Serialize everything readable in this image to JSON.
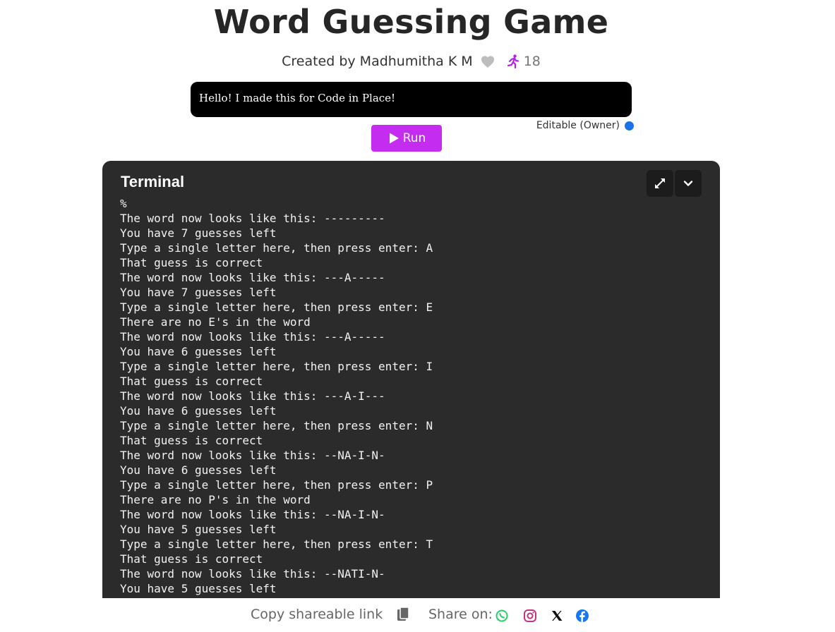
{
  "header": {
    "title": "Word Guessing Game",
    "created_by": "Created by Madhumitha K M",
    "run_count": "18"
  },
  "message": {
    "text": "Hello! I made this for Code in Place!",
    "editable_label": "Editable (Owner)"
  },
  "run_button": {
    "label": "Run",
    "color": "#c42cf0"
  },
  "terminal": {
    "title": "Terminal",
    "lines": [
      "%",
      "The word now looks like this: ---------",
      "You have 7 guesses left",
      "Type a single letter here, then press enter: A",
      "That guess is correct",
      "The word now looks like this: ---A-----",
      "You have 7 guesses left",
      "Type a single letter here, then press enter: E",
      "There are no E's in the word",
      "The word now looks like this: ---A-----",
      "You have 6 guesses left",
      "Type a single letter here, then press enter: I",
      "That guess is correct",
      "The word now looks like this: ---A-I---",
      "You have 6 guesses left",
      "Type a single letter here, then press enter: N",
      "That guess is correct",
      "The word now looks like this: --NA-I-N-",
      "You have 6 guesses left",
      "Type a single letter here, then press enter: P",
      "There are no P's in the word",
      "The word now looks like this: --NA-I-N-",
      "You have 5 guesses left",
      "Type a single letter here, then press enter: T",
      "That guess is correct",
      "The word now looks like this: --NATI-N-",
      "You have 5 guesses left"
    ]
  },
  "footer": {
    "copy_link_label": "Copy shareable link",
    "share_label": "Share on:"
  },
  "icons": {
    "heart": "heart-icon",
    "runner": "runner-icon",
    "play": "play-icon",
    "expand": "expand-icon",
    "collapse": "chevron-down-icon",
    "clipboard": "clipboard-icon",
    "whatsapp": "whatsapp-icon",
    "instagram": "instagram-icon",
    "x": "x-icon",
    "facebook": "facebook-icon"
  },
  "colors": {
    "accent": "#c42cf0",
    "editable_dot": "#1a73e8",
    "terminal_bg": "#2b2b2b"
  }
}
